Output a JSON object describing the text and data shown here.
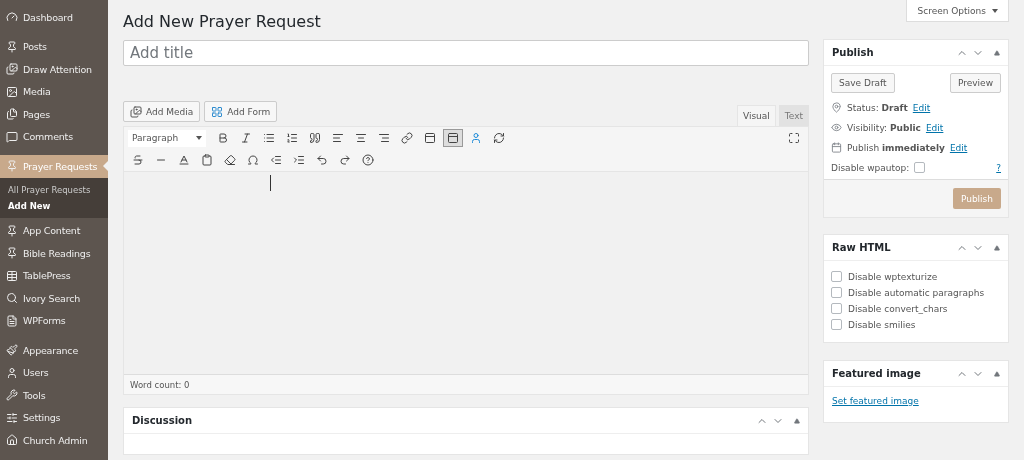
{
  "sidebar": {
    "items": [
      {
        "label": "Dashboard",
        "selected": false
      },
      {
        "label": "Posts",
        "selected": false
      },
      {
        "label": "Draw Attention",
        "selected": false
      },
      {
        "label": "Media",
        "selected": false
      },
      {
        "label": "Pages",
        "selected": false
      },
      {
        "label": "Comments",
        "selected": false
      },
      {
        "label": "Prayer Requests",
        "selected": true,
        "children": [
          {
            "label": "All Prayer Requests",
            "selected": false
          },
          {
            "label": "Add New",
            "selected": true
          }
        ]
      },
      {
        "label": "App Content",
        "selected": false
      },
      {
        "label": "Bible Readings",
        "selected": false
      },
      {
        "label": "TablePress",
        "selected": false
      },
      {
        "label": "Ivory Search",
        "selected": false
      },
      {
        "label": "WPForms",
        "selected": false
      },
      {
        "label": "Appearance",
        "selected": false
      },
      {
        "label": "Users",
        "selected": false
      },
      {
        "label": "Tools",
        "selected": false
      },
      {
        "label": "Settings",
        "selected": false
      },
      {
        "label": "Church Admin",
        "selected": false
      }
    ]
  },
  "screen_options": "Screen Options",
  "page_title": "Add New Prayer Request",
  "title_field": {
    "placeholder": "Add title"
  },
  "media_buttons": [
    "Add Media",
    "Add Form"
  ],
  "editor_tabs": [
    {
      "label": "Visual",
      "selected": true
    },
    {
      "label": "Text",
      "selected": false
    }
  ],
  "format_select": "Paragraph",
  "toolbar_toggle": {
    "selected": true
  },
  "word_count": "Word count: 0",
  "discussion": {
    "title": "Discussion"
  },
  "publish": {
    "title": "Publish",
    "save_draft": "Save Draft",
    "preview": "Preview",
    "rows": [
      {
        "label": "Status:",
        "value": "Draft",
        "link": "Edit"
      },
      {
        "label": "Visibility:",
        "value": "Public",
        "link": "Edit"
      },
      {
        "label": "Publish",
        "value": "immediately",
        "link": "Edit"
      }
    ],
    "wpautop": {
      "label": "Disable wpautop:",
      "checked": false,
      "help": "?"
    },
    "button": "Publish"
  },
  "raw_html": {
    "title": "Raw HTML",
    "options": [
      {
        "label": "Disable wptexturize",
        "checked": false
      },
      {
        "label": "Disable automatic paragraphs",
        "checked": false
      },
      {
        "label": "Disable convert_chars",
        "checked": false
      },
      {
        "label": "Disable smilies",
        "checked": false
      }
    ]
  },
  "featured_image": {
    "title": "Featured image",
    "link": "Set featured image"
  }
}
